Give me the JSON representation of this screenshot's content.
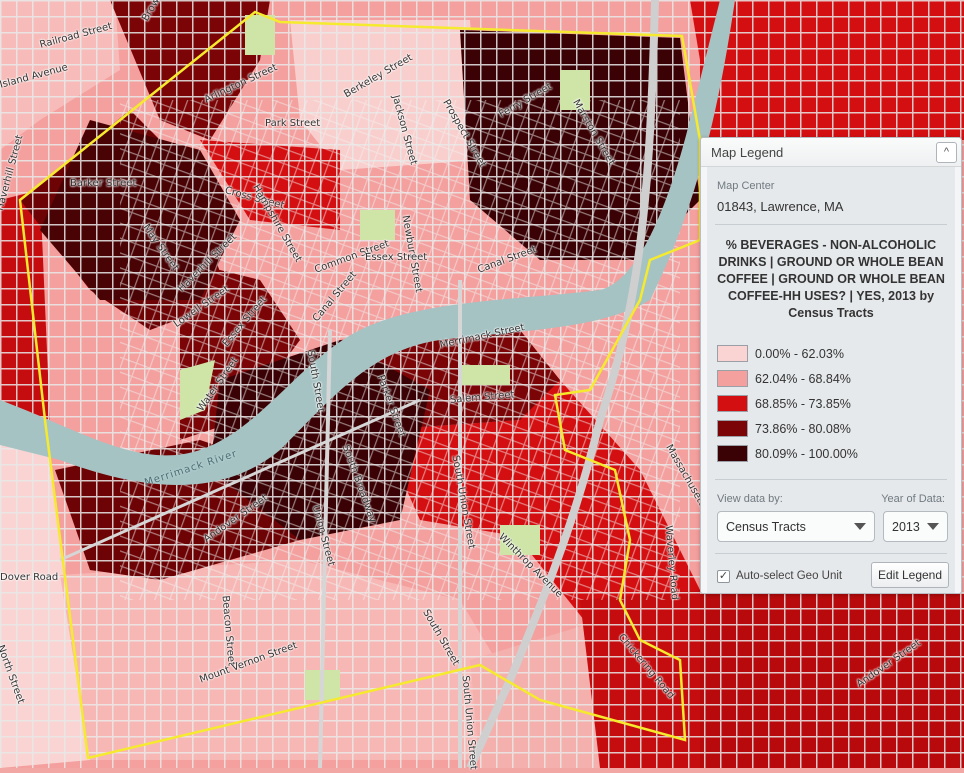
{
  "colors": {
    "class1": "#f9d4d3",
    "class2": "#f3a09e",
    "class3": "#d40f11",
    "class4": "#7a0406",
    "class5": "#3a0204",
    "river": "#a6c3c4",
    "park": "#cfe5a8",
    "road": "#d9d9d9",
    "boundary": "#f5ea2e"
  },
  "map": {
    "streets": [
      "Railroad Street",
      "Island Avenue",
      "Brown Street",
      "Arlington Street",
      "Berkeley Street",
      "Park Street",
      "Jackson Street",
      "Prospect Street",
      "Ferry Street",
      "Marston Street",
      "Barker Street",
      "Cross Street",
      "Newbury Street",
      "Hampshire Street",
      "May Street",
      "Common Street",
      "Essex Street",
      "Canal Street",
      "Haverhill Street",
      "Lowell Street",
      "Essex Street",
      "Canal Street",
      "Merrimack Street",
      "South Street",
      "Salem Street",
      "Parker Street",
      "Water Street",
      "South Broadway",
      "South Union Street",
      "Andover Street",
      "Winthrop Avenue",
      "Beacon Street",
      "Mount Vernon Street",
      "South Street",
      "Waverley Road",
      "Massachusetts Avenue",
      "Andover Street",
      "North Street",
      "Dover Road",
      "South Union Street",
      "Chickering Road",
      "Haverhill Street",
      "Union Street"
    ],
    "river_label": "Merrimack River"
  },
  "legend": {
    "title": "Map Legend",
    "collapse_symbol": "^",
    "map_center_label": "Map Center",
    "map_center_value": "01843, Lawrence, MA",
    "heading": "% BEVERAGES - NON-ALCOHOLIC DRINKS | GROUND OR WHOLE BEAN COFFEE | GROUND OR WHOLE BEAN COFFEE-HH USES? | YES, 2013 by Census Tracts",
    "ranges": [
      "0.00% - 62.03%",
      "62.04% - 68.84%",
      "68.85% - 73.85%",
      "73.86% - 80.08%",
      "80.09% - 100.00%"
    ],
    "view_by_label": "View data by:",
    "view_by_value": "Census Tracts",
    "year_label": "Year of Data:",
    "year_value": "2013",
    "autoselect_label": "Auto-select Geo Unit",
    "autoselect_checked": true,
    "edit_button": "Edit Legend"
  }
}
